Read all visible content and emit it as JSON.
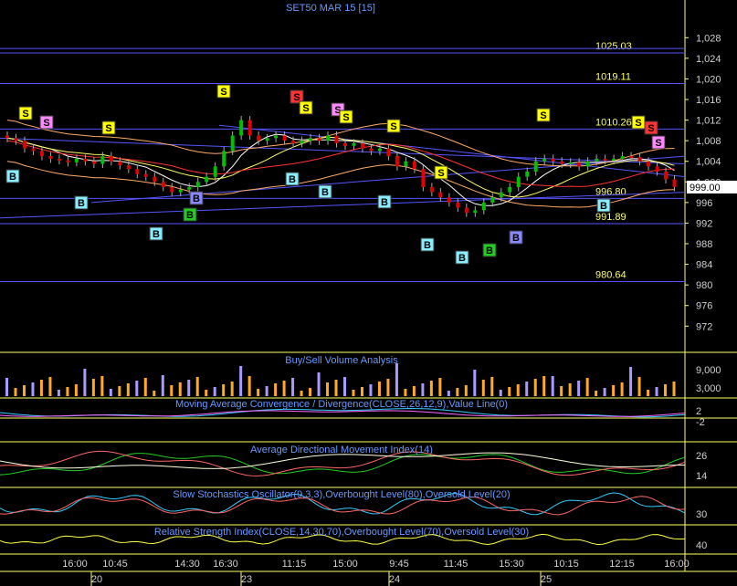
{
  "title": "SET50 MAR 15   [15]",
  "colors": {
    "background": "#000000",
    "frame": "#ffff66",
    "hline": "#5555ff",
    "up_candle": "#00c000",
    "down_candle": "#e00000",
    "axis_text": "#d0d0d0",
    "level_text": "#ffff66",
    "panel_title": "#6699ff",
    "last_price_bg": "#ffffff",
    "last_price_text": "#000000",
    "sell_marker": "#ffff00",
    "sell_marker_alt": "#ff3333",
    "sell_marker_pink": "#ff88ff",
    "buy_marker": "#88eeff",
    "buy_marker_green": "#22cc22",
    "buy_marker_violet": "#8888ff",
    "volume_buy": "#ffaa22",
    "volume_sell": "#aa99ff"
  },
  "main_panel": {
    "y_ticks": [
      "1,028",
      "1,024",
      "1,020",
      "1,016",
      "1,012",
      "1,008",
      "1,004",
      "1,000",
      "996",
      "992",
      "988",
      "984",
      "980",
      "976",
      "972"
    ],
    "levels": [
      {
        "label": "1025.03",
        "value": 1025.03
      },
      {
        "label": "1019.11",
        "value": 1019.11
      },
      {
        "label": "1010.26",
        "value": 1010.26
      },
      {
        "label": "996.80",
        "value": 996.8
      },
      {
        "label": "991.89",
        "value": 991.89
      },
      {
        "label": "980.64",
        "value": 980.64
      }
    ],
    "last_price": "999.00"
  },
  "panels": [
    {
      "id": "volume",
      "title": "Buy/Sell Volume Analysis",
      "ticks": [
        "9,000",
        "3,000"
      ]
    },
    {
      "id": "macd",
      "title": "Moving Average Convergence / Divergence(CLOSE,26,12,9),Value Line(0)",
      "ticks": [
        "2",
        "-2"
      ]
    },
    {
      "id": "adx",
      "title": "Average Directional Movement Index(14)",
      "ticks": [
        "26",
        "14"
      ]
    },
    {
      "id": "stoch",
      "title": "Slow Stochastics Oscillator(9,3,3),Overbought Level(80),Oversold Level(20)",
      "ticks": [
        "30"
      ]
    },
    {
      "id": "rsi",
      "title": "Relative Strength Index(CLOSE,14,30,70),Overbought Level(70),Oversold Level(30)",
      "ticks": [
        "40"
      ]
    }
  ],
  "x_axis": {
    "times": [
      "16:00",
      "10:45",
      "14:30",
      "16:30",
      "11:15",
      "15:00",
      "9:45",
      "11:45",
      "15:30",
      "10:15",
      "12:15",
      "16:00"
    ],
    "dates": [
      "20",
      "23",
      "24",
      "25"
    ]
  },
  "markers": {
    "sell": "S",
    "buy": "B"
  },
  "chart_data": {
    "type": "candlestick",
    "title": "SET50 MAR 15   [15]",
    "ylim": [
      970,
      1030
    ],
    "closes": [
      1008.5,
      1008,
      1006.5,
      1006,
      1005,
      1004.5,
      1004.2,
      1003.8,
      1004.5,
      1004,
      1003.5,
      1005,
      1004,
      1003.2,
      1002.5,
      1001.5,
      1001,
      1000,
      999,
      998,
      998.5,
      999,
      1000,
      1001,
      1003,
      1006,
      1009,
      1012,
      1009,
      1008,
      1008.5,
      1009,
      1008,
      1007.5,
      1008,
      1008.5,
      1008,
      1009,
      1007.5,
      1007,
      1007.5,
      1006.5,
      1006,
      1006.5,
      1005,
      1003,
      1004,
      1002.5,
      999,
      998,
      997,
      996,
      995,
      994,
      994.5,
      996,
      997,
      998,
      999,
      1001,
      1002,
      1004,
      1004.5,
      1004,
      1003.5,
      1003.8,
      1003,
      1004,
      1004.5,
      1004.2,
      1004.5,
      1005,
      1004.8,
      1004,
      1003,
      1002,
      1000.5,
      999
    ]
  }
}
